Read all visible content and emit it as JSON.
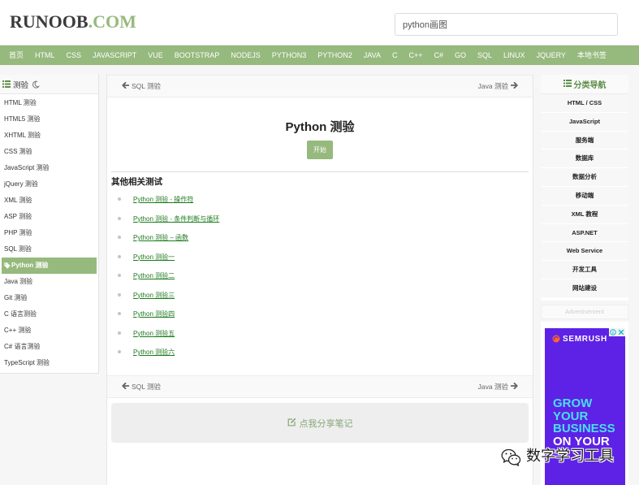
{
  "colors": {
    "brand_green": "#96b97d",
    "link_green": "#1d7a1d",
    "ad_background": "#5d22e5",
    "ad_headline_cyan": "#48e0f0"
  },
  "header": {
    "logo": {
      "main": "RUNOOB",
      "suffix": ".COM"
    },
    "search": {
      "value": "python画图"
    }
  },
  "nav": {
    "items": [
      "首页",
      "HTML",
      "CSS",
      "JAVASCRIPT",
      "VUE",
      "BOOTSTRAP",
      "NODEJS",
      "PYTHON3",
      "PYTHON2",
      "JAVA",
      "C",
      "C++",
      "C#",
      "GO",
      "SQL",
      "LINUX",
      "JQUERY",
      "本地书签"
    ]
  },
  "quiz_sidebar": {
    "title": "测验",
    "title_icon": "list-icon",
    "theme_icon": "moon-icon",
    "active_item_icon": "tag-icon",
    "items": [
      {
        "label": "HTML 测验",
        "active": false
      },
      {
        "label": "HTML5 测验",
        "active": false
      },
      {
        "label": "XHTML 测验",
        "active": false
      },
      {
        "label": "CSS 测验",
        "active": false
      },
      {
        "label": "JavaScript 测验",
        "active": false
      },
      {
        "label": "jQuery 测验",
        "active": false
      },
      {
        "label": "XML 测验",
        "active": false
      },
      {
        "label": "ASP 测验",
        "active": false
      },
      {
        "label": "PHP 测验",
        "active": false
      },
      {
        "label": "SQL 测验",
        "active": false
      },
      {
        "label": "Python 测验",
        "active": true
      },
      {
        "label": "Java 测验",
        "active": false
      },
      {
        "label": "Git 测验",
        "active": false
      },
      {
        "label": "C 语言测验",
        "active": false
      },
      {
        "label": "C++ 测验",
        "active": false
      },
      {
        "label": "C# 语言测验",
        "active": false
      },
      {
        "label": "TypeScript 测验",
        "active": false
      }
    ]
  },
  "quiz": {
    "pager_top": {
      "prev_icon": "arrow-left-icon",
      "prev": "SQL 测验",
      "next": "Java 测验",
      "next_icon": "arrow-right-icon"
    },
    "title": "Python 测验",
    "start_button": "开始",
    "related_heading": "其他相关测试",
    "related_links": [
      "Python 测验 - 操作符",
      "Python 测验 - 条件判断与循环",
      "Python 测验 – 函数",
      "Python 测验一",
      "Python 测验二",
      "Python 测验三",
      "Python 测验四",
      "Python 测验五",
      "Python 测验六"
    ],
    "pager_bottom": {
      "prev": "SQL 测验",
      "next": "Java 测验"
    },
    "share_note": {
      "icon": "edit-icon",
      "label": "点我分享笔记"
    }
  },
  "category_sidebar": {
    "title": "分类导航",
    "title_icon": "list-icon",
    "items": [
      "HTML / CSS",
      "JavaScript",
      "服务端",
      "数据库",
      "数据分析",
      "移动端",
      "XML 教程",
      "ASP.NET",
      "Web Service",
      "开发工具",
      "网站建设"
    ]
  },
  "advertisement": {
    "label": "Advertisement",
    "brand": "SEMRUSH",
    "brand_icon": "semrush-logo-icon",
    "control_icons": [
      "adchoices-info-icon",
      "ad-close-icon"
    ],
    "headline": [
      "GROW",
      "YOUR",
      "BUSINESS",
      "ON YOUR"
    ]
  },
  "watermark": {
    "icon": "wechat-icon",
    "text": "数字学习工具"
  }
}
